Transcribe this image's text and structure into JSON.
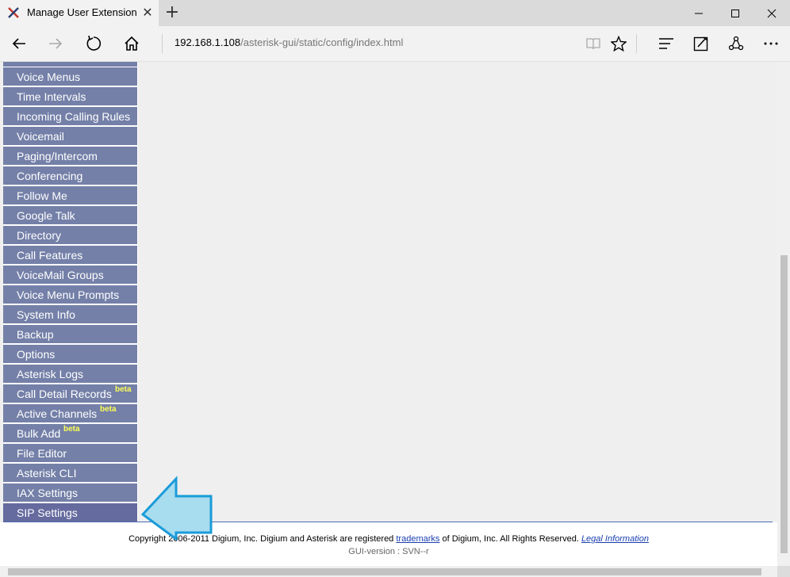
{
  "browser": {
    "tab_title": "Manage User Extension",
    "tab_close_glyph": "✕",
    "new_tab_glyph": "+",
    "address_host": "192.168.1.108",
    "address_path": "/asterisk-gui/static/config/index.html",
    "icons": [
      "back-icon",
      "forward-icon",
      "refresh-icon",
      "home-icon",
      "reading-view-icon",
      "favorite-star-icon",
      "hub-icon",
      "web-note-icon",
      "share-icon",
      "more-icon"
    ]
  },
  "sidebar": {
    "items": [
      {
        "label": "Voice Menus"
      },
      {
        "label": "Time Intervals"
      },
      {
        "label": "Incoming Calling Rules"
      },
      {
        "label": "Voicemail"
      },
      {
        "label": "Paging/Intercom"
      },
      {
        "label": "Conferencing"
      },
      {
        "label": "Follow Me"
      },
      {
        "label": "Google Talk"
      },
      {
        "label": "Directory"
      },
      {
        "label": "Call Features"
      },
      {
        "label": "VoiceMail Groups"
      },
      {
        "label": "Voice Menu Prompts"
      },
      {
        "label": "System Info"
      },
      {
        "label": "Backup"
      },
      {
        "label": "Options"
      },
      {
        "label": "Asterisk Logs"
      },
      {
        "label": "Call Detail Records",
        "badge": "beta"
      },
      {
        "label": "Active Channels",
        "badge": "beta"
      },
      {
        "label": "Bulk Add",
        "badge": "beta"
      },
      {
        "label": "File Editor"
      },
      {
        "label": "Asterisk CLI"
      },
      {
        "label": "IAX Settings"
      },
      {
        "label": "SIP Settings"
      }
    ],
    "active_item": "SIP Settings",
    "colors": {
      "item_bg": "#7480a8",
      "active_bg": "#656b9e",
      "badge": "#ffff55"
    }
  },
  "footer": {
    "copyright_prefix": "Copyright 2006-2011 Digium, Inc. Digium and Asterisk are registered",
    "trademarks_link": "trademarks",
    "copyright_mid": "of Digium, Inc. All Rights Reserved.",
    "legal_link": "Legal Information",
    "version": "GUI-version : SVN--r"
  }
}
